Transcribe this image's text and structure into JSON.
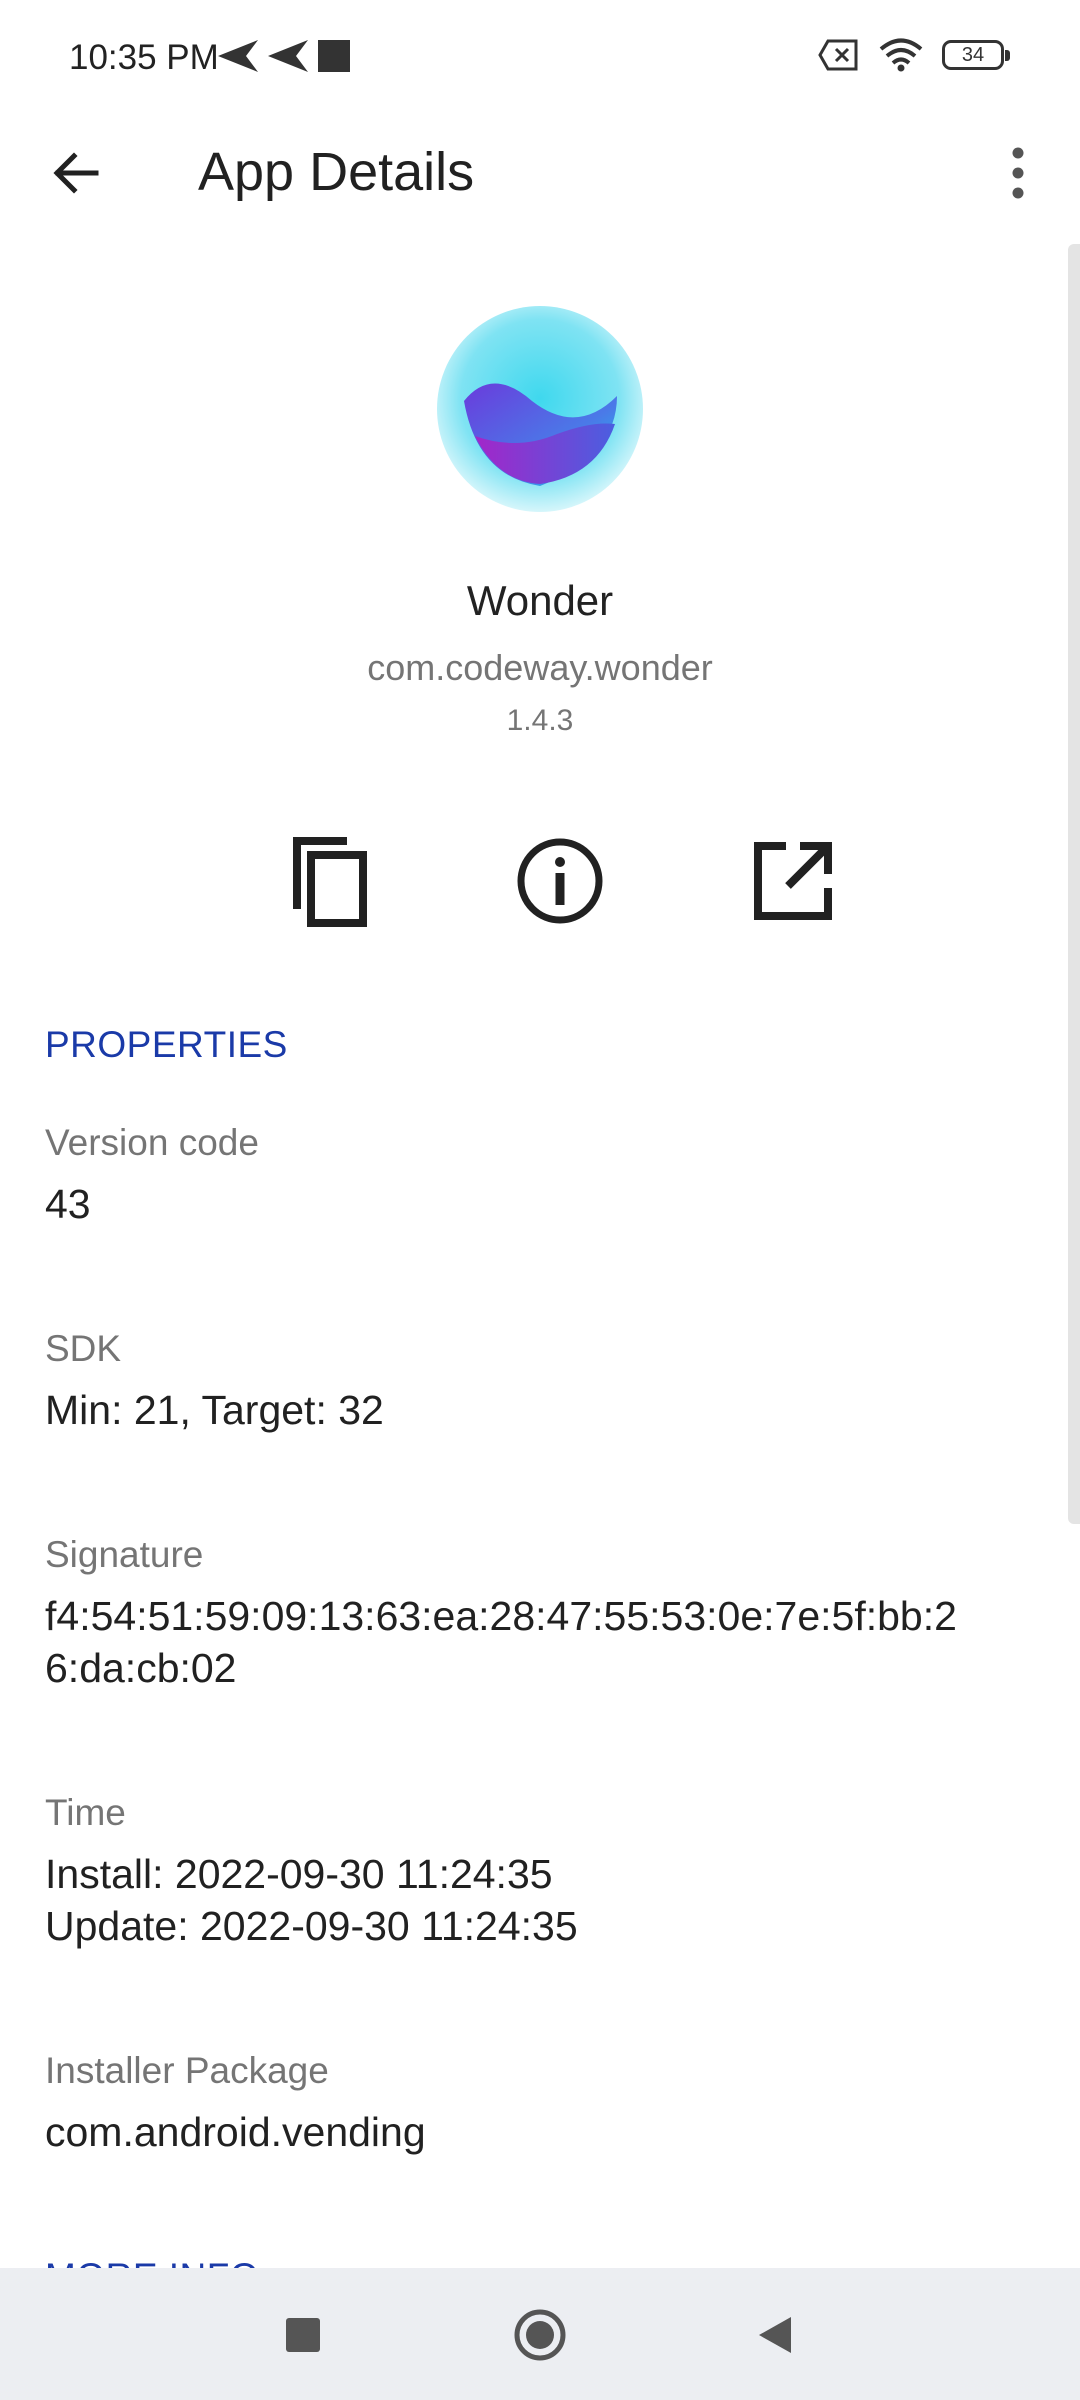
{
  "status_bar": {
    "time": "10:35 PM",
    "battery": "34",
    "icons": [
      "send-icon",
      "send-icon",
      "square-notification-icon",
      "no-sim-icon",
      "wifi-icon",
      "battery-icon"
    ]
  },
  "app_bar": {
    "title": "App Details",
    "back_icon": "arrow-back-icon",
    "menu_icon": "more-vertical-icon"
  },
  "app": {
    "name": "Wonder",
    "package": "com.codeway.wonder",
    "version": "1.4.3"
  },
  "actions": [
    {
      "icon": "copy-icon"
    },
    {
      "icon": "info-icon"
    },
    {
      "icon": "open-external-icon"
    }
  ],
  "properties": {
    "header": "PROPERTIES",
    "items": [
      {
        "label": "Version code",
        "value": "43"
      },
      {
        "label": "SDK",
        "value": "Min: 21, Target: 32"
      },
      {
        "label": "Signature",
        "value": "f4:54:51:59:09:13:63:ea:28:47:55:53:0e:7e:5f:bb:2\n6:da:cb:02"
      },
      {
        "label": "Time",
        "value": "Install: 2022-09-30 11:24:35\nUpdate: 2022-09-30 11:24:35"
      },
      {
        "label": "Installer Package",
        "value": "com.android.vending"
      }
    ]
  },
  "more_info": {
    "header": "MORE INFO"
  },
  "colors": {
    "accent": "#1a3aa8",
    "label_gray": "#757575",
    "nav_bg": "#eceef2"
  }
}
